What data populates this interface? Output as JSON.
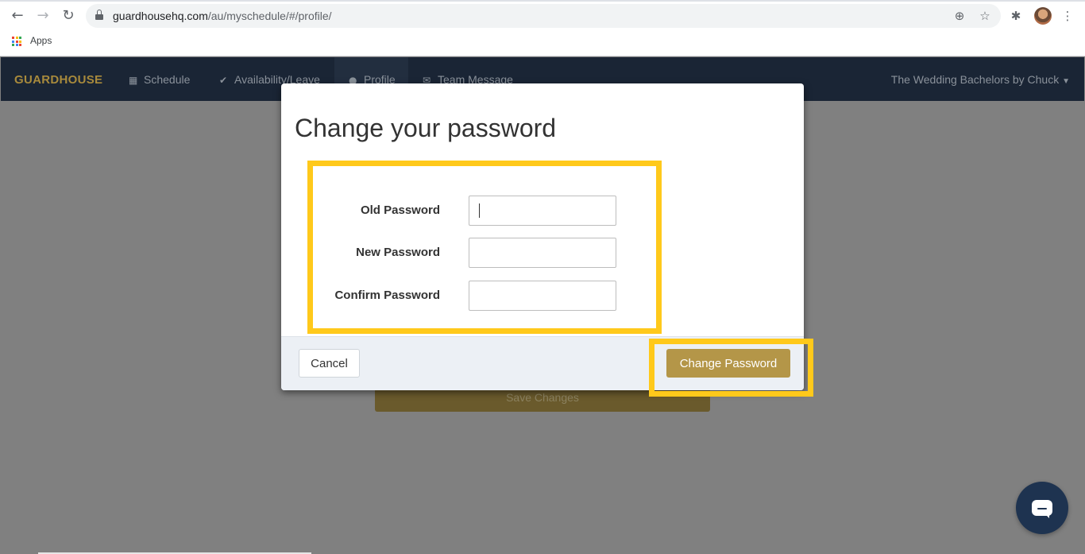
{
  "browser": {
    "url_host": "guardhousehq.com",
    "url_path": "/au/myschedule/#/profile/",
    "bookmarks": [
      {
        "label": "Apps"
      }
    ]
  },
  "app": {
    "brand": "GUARDHOUSE",
    "nav": [
      {
        "label": "Schedule",
        "icon": "calendar-icon"
      },
      {
        "label": "Availability/Leave",
        "icon": "check-icon"
      },
      {
        "label": "Profile",
        "icon": "user-icon"
      },
      {
        "label": "Team Message",
        "icon": "envelope-icon"
      }
    ],
    "org_menu": "The Wedding Bachelors by Chuck",
    "save_changes_label": "Save Changes"
  },
  "modal": {
    "title": "Change your password",
    "fields": [
      {
        "label": "Old Password",
        "value": ""
      },
      {
        "label": "New Password",
        "value": ""
      },
      {
        "label": "Confirm Password",
        "value": ""
      }
    ],
    "cancel_label": "Cancel",
    "submit_label": "Change Password"
  },
  "colors": {
    "highlight": "#ffc91b",
    "accent_gold": "#b49648",
    "navbar": "#1a2535",
    "chat_bubble": "#1e3350"
  }
}
